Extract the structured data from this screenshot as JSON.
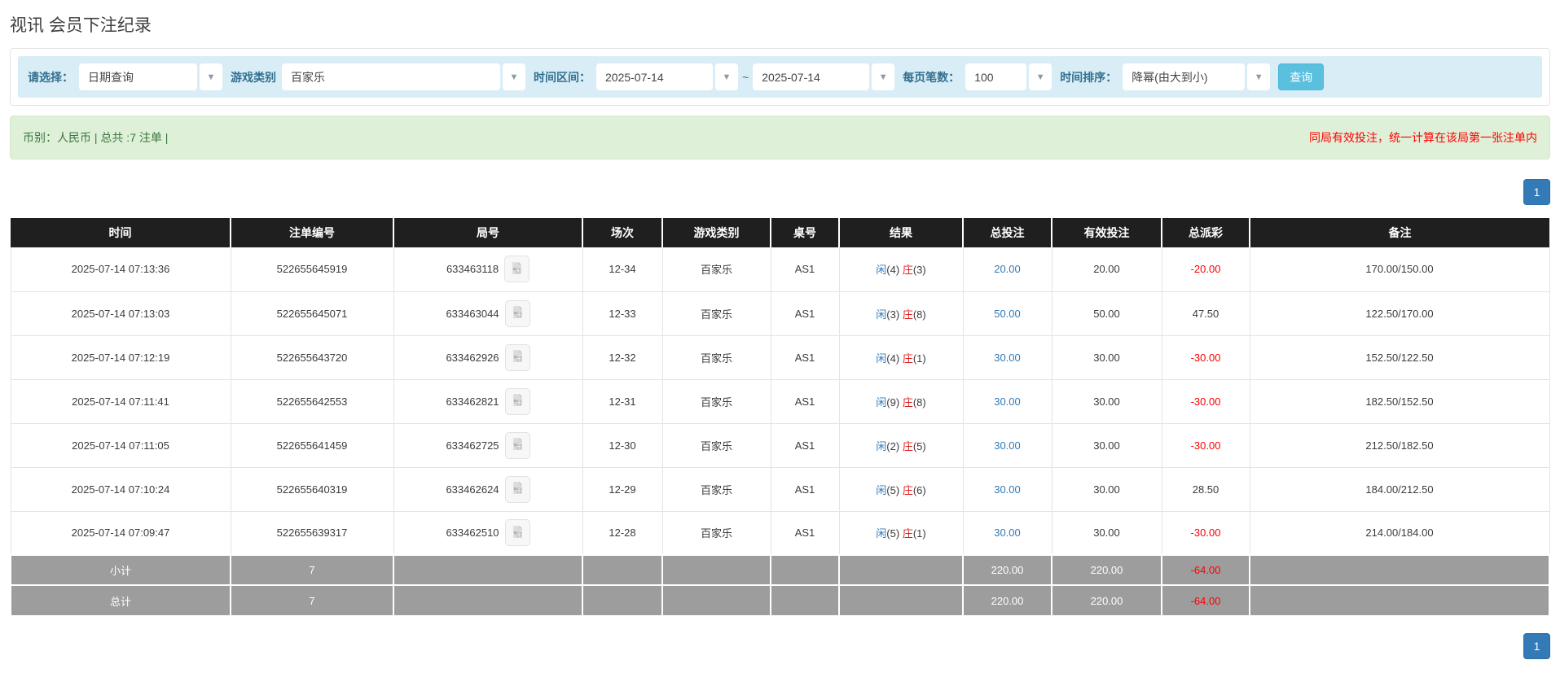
{
  "page": {
    "title": "视讯 会员下注纪录"
  },
  "filters": {
    "select_label": "请选择：",
    "select_value": "日期查询",
    "game_type_label": "游戏类别",
    "game_type_value": "百家乐",
    "time_range_label": "时间区间：",
    "date_from": "2025-07-14",
    "tilde": "~",
    "date_to": "2025-07-14",
    "page_size_label": "每页笔数：",
    "page_size_value": "100",
    "sort_label": "时间排序：",
    "sort_value": "降幂(由大到小)",
    "search_button": "查询",
    "caret": "▼"
  },
  "summary": {
    "left": "币别：人民币 | 总共 :7 注单 |",
    "right": "同局有效投注，统一计算在该局第一张注单内"
  },
  "pagination": {
    "page": "1"
  },
  "table": {
    "headers": [
      "时间",
      "注单编号",
      "局号",
      "场次",
      "游戏类别",
      "桌号",
      "结果",
      "总投注",
      "有效投注",
      "总派彩",
      "备注"
    ],
    "rows": [
      {
        "time": "2025-07-14 07:13:36",
        "bet_id": "522655645919",
        "round_id": "633463118",
        "session": "12-34",
        "game": "百家乐",
        "table_no": "AS1",
        "player_label": "闲",
        "player_score": "(4)",
        "banker_label": "庄",
        "banker_score": "(3)",
        "total_bet": "20.00",
        "valid_bet": "20.00",
        "payout": "-20.00",
        "remark": "170.00/150.00"
      },
      {
        "time": "2025-07-14 07:13:03",
        "bet_id": "522655645071",
        "round_id": "633463044",
        "session": "12-33",
        "game": "百家乐",
        "table_no": "AS1",
        "player_label": "闲",
        "player_score": "(3)",
        "banker_label": "庄",
        "banker_score": "(8)",
        "total_bet": "50.00",
        "valid_bet": "50.00",
        "payout": "47.50",
        "remark": "122.50/170.00"
      },
      {
        "time": "2025-07-14 07:12:19",
        "bet_id": "522655643720",
        "round_id": "633462926",
        "session": "12-32",
        "game": "百家乐",
        "table_no": "AS1",
        "player_label": "闲",
        "player_score": "(4)",
        "banker_label": "庄",
        "banker_score": "(1)",
        "total_bet": "30.00",
        "valid_bet": "30.00",
        "payout": "-30.00",
        "remark": "152.50/122.50"
      },
      {
        "time": "2025-07-14 07:11:41",
        "bet_id": "522655642553",
        "round_id": "633462821",
        "session": "12-31",
        "game": "百家乐",
        "table_no": "AS1",
        "player_label": "闲",
        "player_score": "(9)",
        "banker_label": "庄",
        "banker_score": "(8)",
        "total_bet": "30.00",
        "valid_bet": "30.00",
        "payout": "-30.00",
        "remark": "182.50/152.50"
      },
      {
        "time": "2025-07-14 07:11:05",
        "bet_id": "522655641459",
        "round_id": "633462725",
        "session": "12-30",
        "game": "百家乐",
        "table_no": "AS1",
        "player_label": "闲",
        "player_score": "(2)",
        "banker_label": "庄",
        "banker_score": "(5)",
        "total_bet": "30.00",
        "valid_bet": "30.00",
        "payout": "-30.00",
        "remark": "212.50/182.50"
      },
      {
        "time": "2025-07-14 07:10:24",
        "bet_id": "522655640319",
        "round_id": "633462624",
        "session": "12-29",
        "game": "百家乐",
        "table_no": "AS1",
        "player_label": "闲",
        "player_score": "(5)",
        "banker_label": "庄",
        "banker_score": "(6)",
        "total_bet": "30.00",
        "valid_bet": "30.00",
        "payout": "28.50",
        "remark": "184.00/212.50"
      },
      {
        "time": "2025-07-14 07:09:47",
        "bet_id": "522655639317",
        "round_id": "633462510",
        "session": "12-28",
        "game": "百家乐",
        "table_no": "AS1",
        "player_label": "闲",
        "player_score": "(5)",
        "banker_label": "庄",
        "banker_score": "(1)",
        "total_bet": "30.00",
        "valid_bet": "30.00",
        "payout": "-30.00",
        "remark": "214.00/184.00"
      }
    ],
    "footer": [
      {
        "label": "小计",
        "count": "7",
        "total_bet": "220.00",
        "valid_bet": "220.00",
        "payout": "-64.00"
      },
      {
        "label": "总计",
        "count": "7",
        "total_bet": "220.00",
        "valid_bet": "220.00",
        "payout": "-64.00"
      }
    ]
  }
}
